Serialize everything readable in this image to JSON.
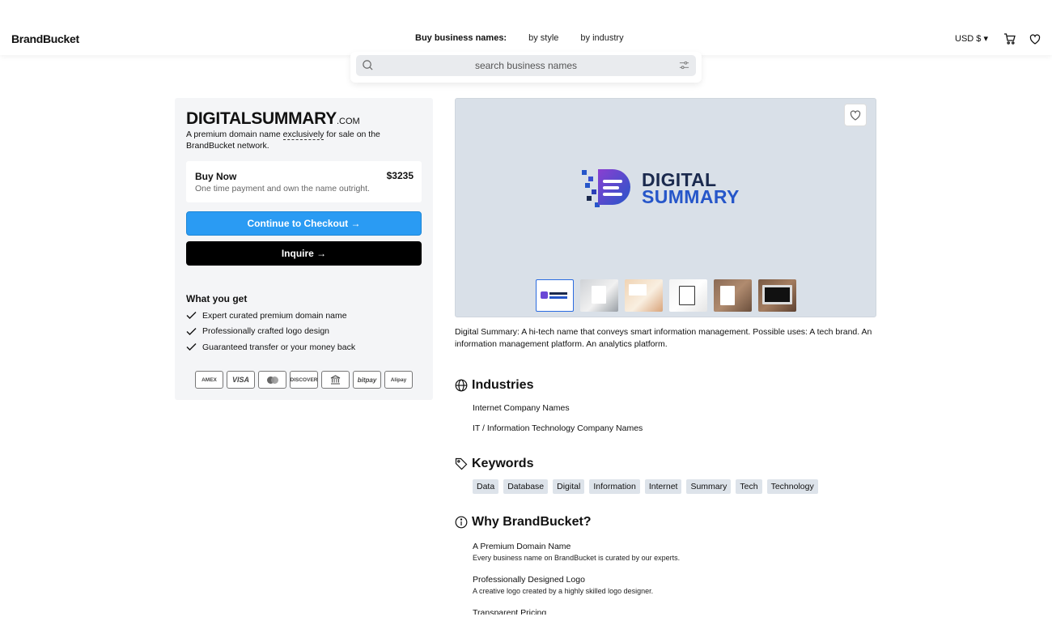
{
  "header": {
    "logo": "BrandBucket",
    "nav_title": "Buy business names:",
    "nav_links": [
      "by style",
      "by industry"
    ],
    "currency": "USD $ ▾"
  },
  "search": {
    "placeholder": "search business names"
  },
  "domain": {
    "name": "DIGITALSUMMARY",
    "tld": ".COM",
    "sub_before": "A premium domain name ",
    "sub_emph": "exclusively",
    "sub_after": " for sale on the BrandBucket network."
  },
  "buy": {
    "title": "Buy Now",
    "price": "$3235",
    "note": "One time payment and own the name outright."
  },
  "buttons": {
    "checkout": "Continue to Checkout →",
    "inquire": "Inquire →"
  },
  "what_you_get": {
    "title": "What you get",
    "items": [
      "Expert curated premium domain name",
      "Professionally crafted logo design",
      "Guaranteed transfer or your money back"
    ]
  },
  "payments": [
    "AMEX",
    "VISA",
    "mastercard",
    "DISCOVER",
    "bank",
    "bitpay",
    "Alipay"
  ],
  "hero": {
    "logo_line1": "DIGITAL",
    "logo_line2": "SUMMARY",
    "thumb_count": 6
  },
  "description": "Digital Summary: A hi-tech name that conveys smart information management. Possible uses: A tech brand. An information management platform. An analytics platform.",
  "industries": {
    "title": "Industries",
    "items": [
      "Internet Company Names",
      "IT / Information Technology Company Names"
    ]
  },
  "keywords": {
    "title": "Keywords",
    "items": [
      "Data",
      "Database",
      "Digital",
      "Information",
      "Internet",
      "Summary",
      "Tech",
      "Technology"
    ]
  },
  "why": {
    "title": "Why BrandBucket?",
    "items": [
      {
        "title": "A Premium Domain Name",
        "desc": "Every business name on BrandBucket is curated by our experts."
      },
      {
        "title": "Professionally Designed Logo",
        "desc": "A creative logo created by a highly skilled logo designer."
      },
      {
        "title": "Transparent Pricing",
        "desc": ""
      }
    ]
  },
  "colors": {
    "checkout_button": "#2a9bf3",
    "inquire_button": "#000000",
    "hero_bg": "#d9e0e8",
    "keyword_chip": "#dde3ea",
    "logo_navy": "#1b2a4e",
    "logo_blue": "#2656c9",
    "logo_purple": "#8a3fd1"
  }
}
